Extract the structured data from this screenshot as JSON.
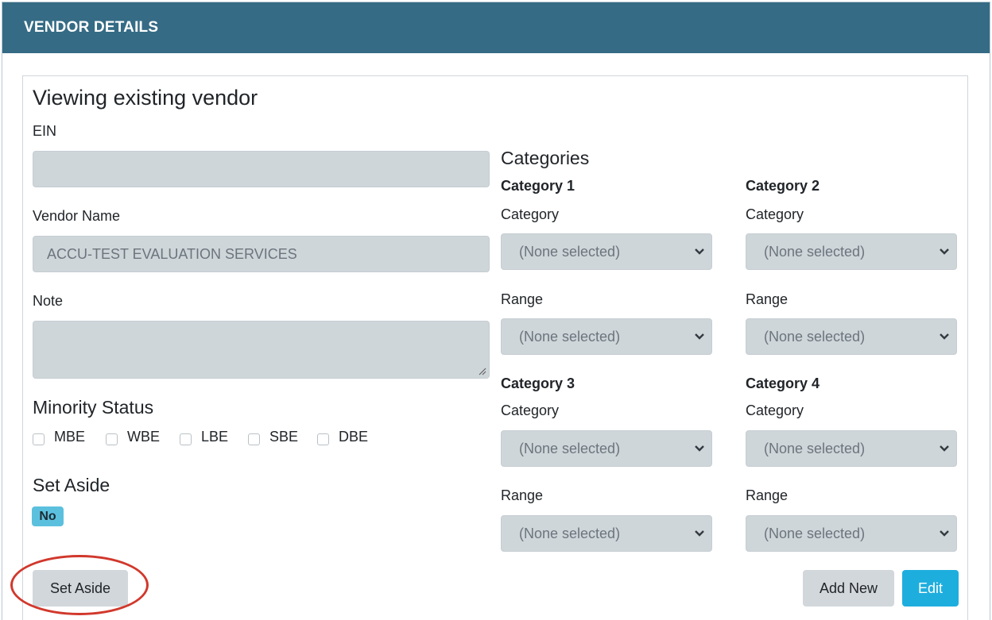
{
  "panel": {
    "title": "VENDOR DETAILS"
  },
  "card": {
    "heading": "Viewing existing vendor"
  },
  "form": {
    "ein_label": "EIN",
    "ein_value": "",
    "vendor_name_label": "Vendor Name",
    "vendor_name_value": "ACCU-TEST EVALUATION SERVICES",
    "note_label": "Note",
    "note_value": ""
  },
  "minority_status": {
    "heading": "Minority Status",
    "options": [
      {
        "label": "MBE",
        "checked": false
      },
      {
        "label": "WBE",
        "checked": false
      },
      {
        "label": "LBE",
        "checked": false
      },
      {
        "label": "SBE",
        "checked": false
      },
      {
        "label": "DBE",
        "checked": false
      }
    ]
  },
  "set_aside": {
    "heading": "Set Aside",
    "badge": "No",
    "button_label": "Set Aside"
  },
  "categories": {
    "heading": "Categories",
    "category_label": "Category",
    "range_label": "Range",
    "groups": [
      {
        "title": "Category 1",
        "category_value": "(None selected)",
        "range_value": "(None selected)"
      },
      {
        "title": "Category 2",
        "category_value": "(None selected)",
        "range_value": "(None selected)"
      },
      {
        "title": "Category 3",
        "category_value": "(None selected)",
        "range_value": "(None selected)"
      },
      {
        "title": "Category 4",
        "category_value": "(None selected)",
        "range_value": "(None selected)"
      }
    ]
  },
  "actions": {
    "add_new_label": "Add New",
    "edit_label": "Edit"
  },
  "colors": {
    "header": "#356b85",
    "badge": "#5bc0de",
    "edit_button": "#1eaede",
    "annotation": "#d1382c"
  }
}
